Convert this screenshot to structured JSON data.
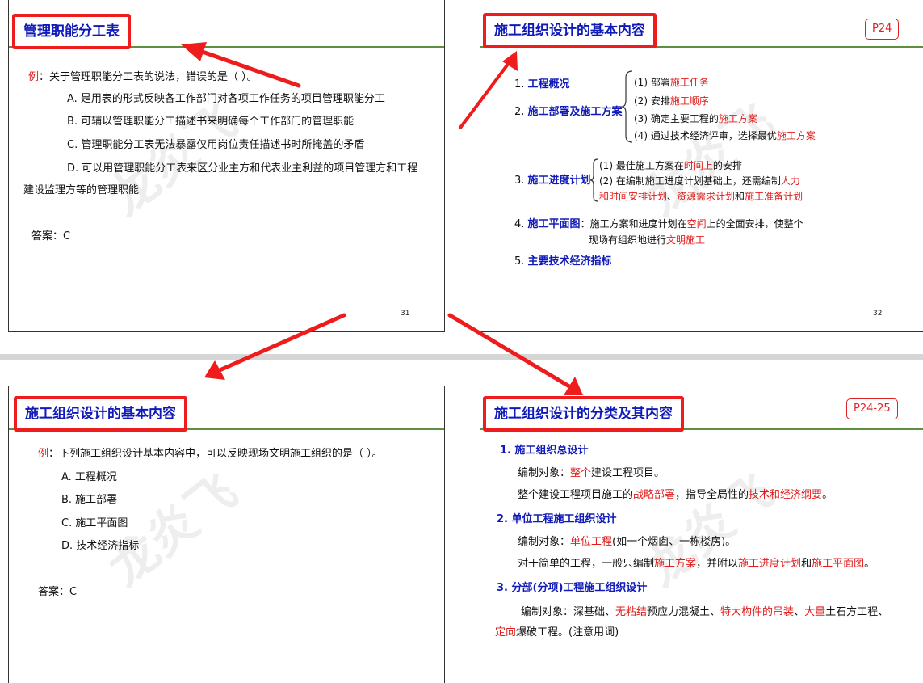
{
  "slide31": {
    "title": "管理职能分工表",
    "q_prefix": "例",
    "q_text": "：关于管理职能分工表的说法，错误的是（ ）。",
    "options": [
      "A. 是用表的形式反映各工作部门对各项工作任务的项目管理职能分工",
      "B. 可辅以管理职能分工描述书来明确每个工作部门的管理职能",
      "C. 管理职能分工表无法暴露仅用岗位责任描述书时所掩盖的矛盾",
      "D. 可以用管理职能分工表来区分业主方和代表业主利益的项目管理方和工程"
    ],
    "option_d_cont": "建设监理方等的管理职能",
    "answer": "答案：C",
    "page": "31",
    "watermark": "龙炎飞"
  },
  "slide32": {
    "title": "施工组织设计的基本内容",
    "tag": "P24",
    "i1": "1. ",
    "i1b": "工程概况",
    "i2": "2. ",
    "i2b": "施工部署及施工方案",
    "s1a": "(1) 部署",
    "s1r": "施工任务",
    "s2a": "(2) 安排",
    "s2r": "施工顺序",
    "s3a": "(3) 确定主要工程的",
    "s3r": "施工方案",
    "s4a": "(4) 通过技术经济评审，选择最优",
    "s4r": "施工方案",
    "i3": "3. ",
    "i3b": "施工进度计划",
    "p1a": "(1) 最佳施工方案在",
    "p1r": "时间上",
    "p1c": "的安排",
    "p2a": "(2) 在编制施工进度计划基础上，还需编制",
    "p2r": "人力",
    "p3r1": "和时间安排计划",
    "p3a": "、",
    "p3r2": "资源需求计划",
    "p3b": "和",
    "p3r3": "施工准备计划",
    "i4": "4. ",
    "i4b": "施工平面图",
    "i4t1": "：施工方案和进度计划在",
    "i4r1": "空间",
    "i4t2": "上的全面安排，使整个",
    "i4l2a": "现场有组织地进行",
    "i4r2": "文明施工",
    "i5": "5. ",
    "i5b": "主要技术经济指标",
    "page": "32",
    "watermark": "龙炎飞"
  },
  "slide33": {
    "title": "施工组织设计的基本内容",
    "q_prefix": "例",
    "q_text": "：下列施工组织设计基本内容中，可以反映现场文明施工组织的是（ ）。",
    "options": [
      "A. 工程概况",
      "B. 施工部署",
      "C. 施工平面图",
      "D. 技术经济指标"
    ],
    "answer": "答案：C",
    "watermark": "龙炎飞"
  },
  "slide34": {
    "title": "施工组织设计的分类及其内容",
    "tag": "P24-25",
    "h1": "1. 施工组织总设计",
    "l1a": "编制对象：",
    "l1r": "整个",
    "l1b": "建设工程项目。",
    "l2a": "整个建设工程项目施工的",
    "l2r1": "战略部署",
    "l2b": "，指导全局性的",
    "l2r2": "技术和经济纲要",
    "l2c": "。",
    "h2": "2. 单位工程施工组织设计",
    "l3a": "编制对象：",
    "l3r": "单位工程",
    "l3b": "(如一个烟囱、一栋楼房)。",
    "l4a": "对于简单的工程，一般只编制",
    "l4r1": "施工方案",
    "l4b": "，并附以",
    "l4r2": "施工进度计划",
    "l4c": "和",
    "l4r3": "施工平面图",
    "l4d": "。",
    "h3": "3. 分部(分项)工程施工组织设计",
    "l5a": "编制对象：深基础、",
    "l5r1": "无粘结",
    "l5b": "预应力混凝土、",
    "l5r2": "特大构件的吊装",
    "l5c": "、",
    "l5r3": "大量",
    "l5d": "土石方工程、",
    "l6r": "定向",
    "l6a": "爆破工程。(注意用词)",
    "watermark": "龙炎飞"
  },
  "colors": {
    "title_blue": "#0f1ab8",
    "highlight_red": "#e01c1c",
    "frame_red": "#ee1c1c",
    "rule_green": "#5f8f3e"
  }
}
